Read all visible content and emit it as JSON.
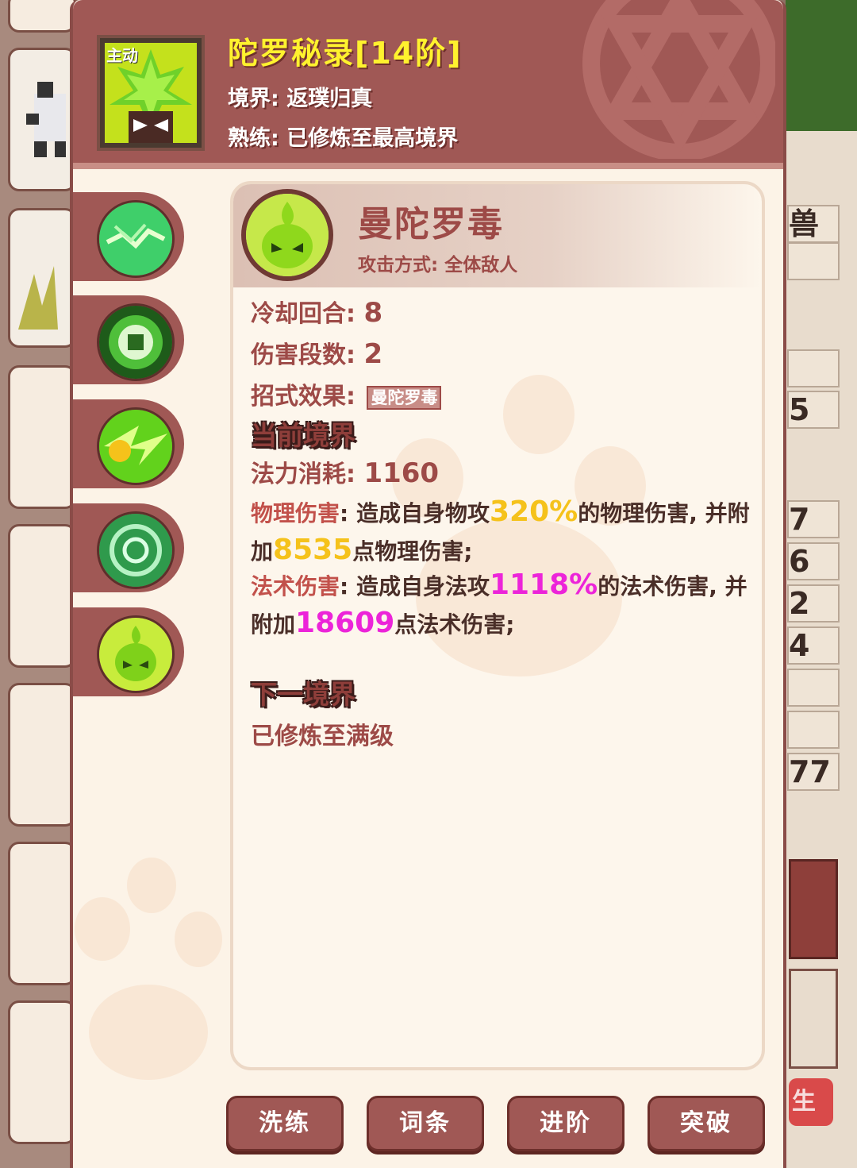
{
  "header": {
    "active_tag": "主动",
    "title": "陀罗秘录[14阶]",
    "realm": "境界: 返璞归真",
    "proficiency": "熟练: 已修炼至最高境界"
  },
  "skill": {
    "name": "曼陀罗毒",
    "attack_mode": "攻击方式: 全体敌人",
    "cooldown_label": "冷却回合: ",
    "cooldown_value": "8",
    "hits_label": "伤害段数: ",
    "hits_value": "2",
    "effect_label": "招式效果: ",
    "effect_tag": "曼陀罗毒"
  },
  "current_realm": {
    "heading": "当前境界",
    "mana_label": "法力消耗: ",
    "mana_value": "1160",
    "phys_label": "物理伤害",
    "phys_text1": ": 造成自身物攻",
    "phys_pct": "320%",
    "phys_text2": "的物理伤害, 并附加",
    "phys_flat": "8535",
    "phys_text3": "点物理伤害;",
    "magic_label": "法术伤害",
    "magic_text1": ": 造成自身法攻",
    "magic_pct": "1118%",
    "magic_text2": "的法术伤害, 并附加",
    "magic_flat": "18609",
    "magic_text3": "点法术伤害;"
  },
  "next_realm": {
    "heading": "下一境界",
    "text": "已修炼至满级"
  },
  "buttons": [
    "洗练",
    "词条",
    "进阶",
    "突破"
  ],
  "background": {
    "right_cells": [
      "兽",
      "5",
      "7",
      "6",
      "2",
      "4",
      "77"
    ],
    "right_red_label": "生"
  },
  "colors": {
    "title_yellow": "#fff22e",
    "header_bg": "#a05855",
    "highlight_yellow": "#f5c21b",
    "highlight_magenta": "#ec24d9"
  }
}
